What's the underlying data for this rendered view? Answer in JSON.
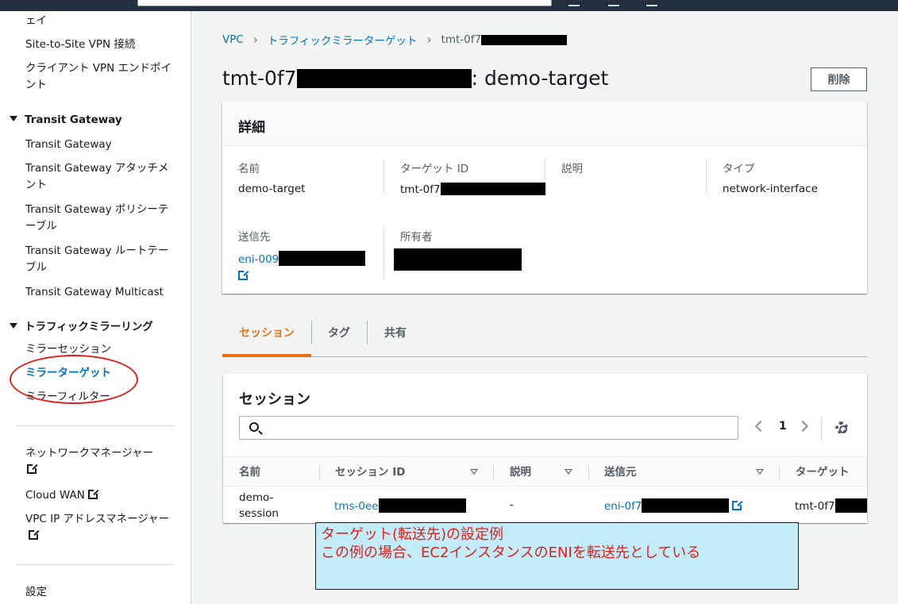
{
  "sidebar": {
    "items_top": [
      "ェイ",
      "Site-to-Site VPN 接続",
      "クライアント VPN エンドポイント"
    ],
    "transit_section": "Transit Gateway",
    "transit_items": [
      "Transit Gateway",
      "Transit Gateway アタッチメント",
      "Transit Gateway ポリシーテーブル",
      "Transit Gateway ルートテーブル",
      "Transit Gateway Multicast"
    ],
    "mirror_section": "トラフィックミラーリング",
    "mirror_items": [
      "ミラーセッション",
      "ミラーターゲット",
      "ミラーフィルター"
    ],
    "other_items": [
      "ネットワークマネージャー",
      "Cloud WAN",
      "VPC IP アドレスマネージャー"
    ],
    "settings": "設定"
  },
  "breadcrumb": {
    "root": "VPC",
    "parent": "トラフィックミラーターゲット",
    "current": "tmt-0f7"
  },
  "page": {
    "title_prefix": "tmt-0f7",
    "title_suffix": ": demo-target",
    "delete_label": "削除"
  },
  "details": {
    "heading": "詳細",
    "name_label": "名前",
    "name_value": "demo-target",
    "target_id_label": "ターゲット ID",
    "target_id_value": "tmt-0f7",
    "desc_label": "説明",
    "type_label": "タイプ",
    "type_value": "network-interface",
    "dest_label": "送信先",
    "dest_value": "eni-009",
    "owner_label": "所有者"
  },
  "tabs": [
    "セッション",
    "タグ",
    "共有"
  ],
  "sessions": {
    "heading": "セッション",
    "page_number": "1",
    "columns": [
      "名前",
      "セッション ID",
      "説明",
      "送信元",
      "ターゲット"
    ],
    "row": {
      "name": "demo-session",
      "session_id": "tms-0ee",
      "description": "-",
      "source": "eni-0f7",
      "target": "tmt-0f7"
    }
  },
  "annotation": {
    "line1": "ターゲット(転送先)の設定例",
    "line2": "この例の場合、EC2インスタンスのENIを転送先としている"
  },
  "colors": {
    "accent": "#ec7211",
    "link": "#0073bb",
    "annotation_red": "#e0201b",
    "callout_bg": "#c3ecfa"
  }
}
